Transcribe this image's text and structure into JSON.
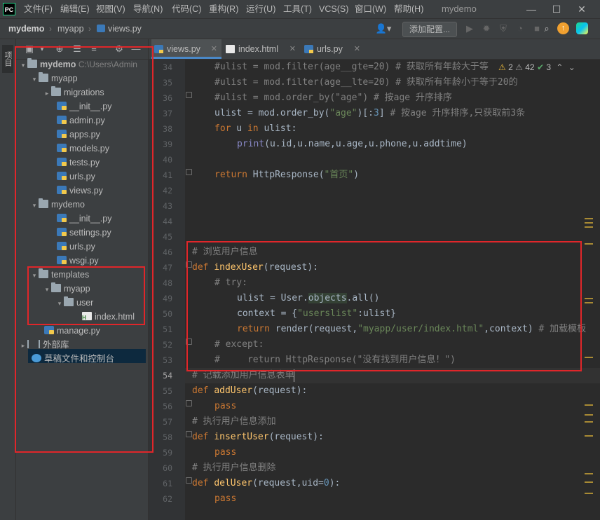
{
  "titlebar": {
    "logo": "PC",
    "menus": [
      "文件(F)",
      "编辑(E)",
      "视图(V)",
      "导航(N)",
      "代码(C)",
      "重构(R)",
      "运行(U)",
      "工具(T)",
      "VCS(S)",
      "窗口(W)",
      "帮助(H)"
    ],
    "window_title": "mydemo",
    "controls": {
      "minimize": "—",
      "maximize": "☐",
      "close": "✕"
    }
  },
  "navbar": {
    "breadcrumbs": [
      "mydemo",
      "myapp",
      "views.py"
    ],
    "add_config_label": "添加配置..."
  },
  "left_strip": {
    "project_tab": "项目"
  },
  "project_tree": {
    "rows": [
      {
        "label": "mydemo",
        "hint": "C:\\Users\\Admin",
        "type": "folder",
        "arrow": "▾"
      },
      {
        "label": "myapp",
        "type": "folder",
        "arrow": "▾"
      },
      {
        "label": "migrations",
        "type": "folder",
        "arrow": "▸"
      },
      {
        "label": "__init__.py",
        "type": "py"
      },
      {
        "label": "admin.py",
        "type": "py"
      },
      {
        "label": "apps.py",
        "type": "py"
      },
      {
        "label": "models.py",
        "type": "py"
      },
      {
        "label": "tests.py",
        "type": "py"
      },
      {
        "label": "urls.py",
        "type": "py"
      },
      {
        "label": "views.py",
        "type": "py"
      },
      {
        "label": "mydemo",
        "type": "folder",
        "arrow": "▾"
      },
      {
        "label": "__init__.py",
        "type": "py"
      },
      {
        "label": "settings.py",
        "type": "py"
      },
      {
        "label": "urls.py",
        "type": "py"
      },
      {
        "label": "wsgi.py",
        "type": "py"
      },
      {
        "label": "templates",
        "type": "folder",
        "arrow": "▾"
      },
      {
        "label": "myapp",
        "type": "folder",
        "arrow": "▾"
      },
      {
        "label": "user",
        "type": "folder",
        "arrow": "▾"
      },
      {
        "label": "index.html",
        "type": "html",
        "selected": true
      },
      {
        "label": "manage.py",
        "type": "py"
      },
      {
        "label": "外部库",
        "type": "lib",
        "arrow": "▸"
      },
      {
        "label": "草稿文件和控制台",
        "type": "scratch"
      }
    ]
  },
  "tabs": [
    {
      "label": "views.py",
      "active": true
    },
    {
      "label": "index.html",
      "active": false
    },
    {
      "label": "urls.py",
      "active": false
    }
  ],
  "inspections": {
    "warnings": "2",
    "weak_warnings": "42",
    "ok": "3"
  },
  "editor": {
    "current_line": "54",
    "line_numbers": [
      "34",
      "35",
      "36",
      "37",
      "38",
      "39",
      "40",
      "41",
      "42",
      "43",
      "44",
      "45",
      "46",
      "47",
      "48",
      "49",
      "50",
      "51",
      "52",
      "53",
      "54",
      "55",
      "56",
      "57",
      "58",
      "59",
      "60",
      "61",
      "62"
    ],
    "lines": {
      "l34_a": "#ulist = mod.filter(age__gte=20) # 获取所有年龄大于等",
      "l35_a": "#ulist = mod.filter(age__lte=20) # 获取所有年龄小于等于20的",
      "l36_a": "#ulist = mod.order_by(\"age\") # 按age 升序排序",
      "l37_a": "ulist = mod.order_by(",
      "l37_b": "\"age\"",
      "l37_c": ")[:",
      "l37_d": "3",
      "l37_e": "] ",
      "l37_f": "# 按age 升序排序,只获取前3条",
      "l38_a": "for",
      "l38_b": " u ",
      "l38_c": "in",
      "l38_d": " ulist:",
      "l39_a": "print",
      "l39_b": "(u.id,u.name,u.age,u.phone,u.addtime)",
      "l41_a": "return",
      "l41_b": " HttpResponse(",
      "l41_c": "\"首页\"",
      "l41_d": ")",
      "l46_a": "# 浏览用户信息",
      "l47_a": "def",
      "l47_b": "indexUser",
      "l47_c": "(request):",
      "l48_a": "# try:",
      "l49_a": "ulist = User.",
      "l49_b": "objects",
      "l49_c": ".all()",
      "l50_a": "context = {",
      "l50_b": "\"userslist\"",
      "l50_c": ":ulist}",
      "l51_a": "return",
      "l51_b": " render(request,",
      "l51_c": "\"myapp/user/index.html\"",
      "l51_d": ",context) ",
      "l51_e": "# 加载模板",
      "l52_a": "# except:",
      "l53_a": "#     return HttpResponse(\"没有找到用户信息！\")",
      "l54_a": "# 记载添加用户信息表单",
      "l55_a": "def",
      "l55_b": "addUser",
      "l55_c": "(request):",
      "l56_a": "pass",
      "l57_a": "# 执行用户信息添加",
      "l58_a": "def",
      "l58_b": "insertUser",
      "l58_c": "(request):",
      "l59_a": "pass",
      "l60_a": "# 执行用户信息删除",
      "l61_a": "def",
      "l61_b": "delUser",
      "l61_c": "(request,uid=",
      "l61_d": "0",
      "l61_e": "):",
      "l62_a": "pass"
    }
  },
  "colors": {
    "annotation": "#e0262a",
    "accent": "#4a88c7",
    "selection": "#0d293e"
  }
}
